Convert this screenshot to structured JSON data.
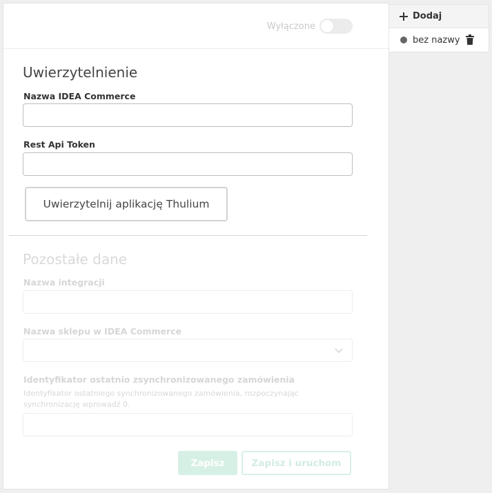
{
  "header": {
    "toggle_label": "Wyłączone"
  },
  "auth": {
    "title": "Uwierzytelnienie",
    "idea_name_label": "Nazwa IDEA Commerce",
    "idea_name_value": "",
    "token_label": "Rest Api Token",
    "token_value": "",
    "auth_button": "Uwierzytelnij aplikację Thulium"
  },
  "other": {
    "title": "Pozostałe dane",
    "integration_name_label": "Nazwa integracji",
    "integration_name_value": "",
    "shop_label": "Nazwa sklepu w IDEA Commerce",
    "shop_value": "",
    "last_order_label": "Identyfikator ostatnio zsynchronizowanego zamówienia",
    "last_order_hint": "Identyfikator ostatniego synchronizowanego zamówienia, rozpoczynając synchronizację wprowadź 0.",
    "last_order_value": ""
  },
  "actions": {
    "save": "Zapisz",
    "save_run": "Zapisz i uruchom"
  },
  "sidebar": {
    "add_label": "Dodaj",
    "items": [
      {
        "label": "bez nazwy"
      }
    ]
  },
  "colors": {
    "accent_disabled": "#d7f0e6",
    "status_dot": "#666666"
  },
  "icons": {
    "add": "plus-icon",
    "delete": "trash-icon",
    "select": "chevron-down-icon"
  }
}
